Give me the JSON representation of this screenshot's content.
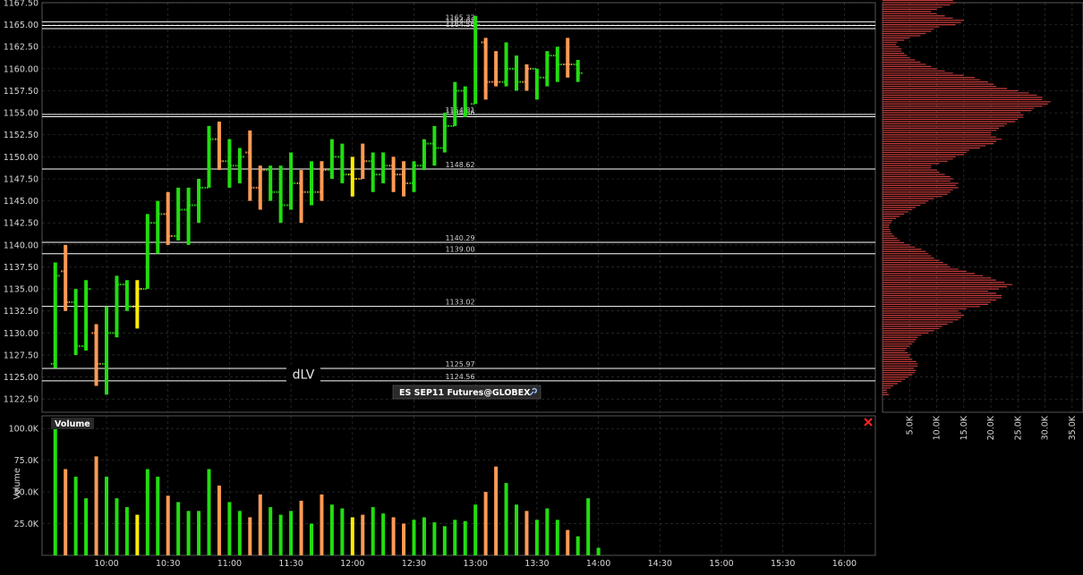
{
  "colors": {
    "background": "#000000",
    "grid": "#3a3a3a",
    "up": "#22dd11",
    "down": "#ff9a55",
    "neutral": "#ffee00",
    "level_line": "#ffffff",
    "profile": "#c83c3c",
    "label_bg": "#2a2a2a",
    "close_icon": "#ff2222"
  },
  "chart_data": [
    {
      "type": "ohlc",
      "title": "ES SEP11 Futures@GLOBEX",
      "title_icon": "wrench-icon",
      "ylim": [
        1121.0,
        1167.5
      ],
      "yticks": [
        "1122.50",
        "1125.00",
        "1127.50",
        "1130.00",
        "1132.50",
        "1135.00",
        "1137.50",
        "1140.00",
        "1142.50",
        "1145.00",
        "1147.50",
        "1150.00",
        "1152.50",
        "1155.00",
        "1157.50",
        "1160.00",
        "1162.50",
        "1165.00",
        "1167.50"
      ],
      "xticks": [
        "10:00",
        "10:30",
        "11:00",
        "11:30",
        "12:00",
        "12:30",
        "13:00",
        "13:30",
        "14:00",
        "14:30",
        "15:00",
        "15:30",
        "16:00"
      ],
      "bar_interval": "5min",
      "first_bar_time": "09:35",
      "bars": [
        {
          "o": 1126.5,
          "h": 1138.0,
          "l": 1126.0,
          "c": 1136.5,
          "color": "up"
        },
        {
          "o": 1137.0,
          "h": 1140.0,
          "l": 1132.5,
          "c": 1133.5,
          "color": "down"
        },
        {
          "o": 1133.5,
          "h": 1135.0,
          "l": 1127.5,
          "c": 1128.5,
          "color": "up"
        },
        {
          "o": 1128.5,
          "h": 1136.0,
          "l": 1128.0,
          "c": 1135.0,
          "color": "up"
        },
        {
          "o": 1130.0,
          "h": 1131.0,
          "l": 1124.0,
          "c": 1126.5,
          "color": "down"
        },
        {
          "o": 1126.5,
          "h": 1133.0,
          "l": 1123.0,
          "c": 1130.0,
          "color": "up"
        },
        {
          "o": 1130.0,
          "h": 1136.5,
          "l": 1129.5,
          "c": 1135.5,
          "color": "up"
        },
        {
          "o": 1135.5,
          "h": 1136.0,
          "l": 1132.5,
          "c": 1133.0,
          "color": "up"
        },
        {
          "o": 1133.0,
          "h": 1136.0,
          "l": 1130.5,
          "c": 1135.0,
          "color": "neutral"
        },
        {
          "o": 1135.0,
          "h": 1143.5,
          "l": 1135.0,
          "c": 1142.5,
          "color": "up"
        },
        {
          "o": 1142.5,
          "h": 1145.0,
          "l": 1139.0,
          "c": 1143.5,
          "color": "up"
        },
        {
          "o": 1143.5,
          "h": 1146.0,
          "l": 1140.0,
          "c": 1141.0,
          "color": "down"
        },
        {
          "o": 1141.0,
          "h": 1146.5,
          "l": 1140.5,
          "c": 1144.0,
          "color": "up"
        },
        {
          "o": 1144.0,
          "h": 1146.5,
          "l": 1140.0,
          "c": 1144.5,
          "color": "up"
        },
        {
          "o": 1144.5,
          "h": 1147.5,
          "l": 1142.5,
          "c": 1146.5,
          "color": "up"
        },
        {
          "o": 1146.5,
          "h": 1153.5,
          "l": 1146.5,
          "c": 1152.0,
          "color": "up"
        },
        {
          "o": 1152.0,
          "h": 1154.0,
          "l": 1148.5,
          "c": 1149.5,
          "color": "down"
        },
        {
          "o": 1149.5,
          "h": 1152.0,
          "l": 1146.5,
          "c": 1149.0,
          "color": "up"
        },
        {
          "o": 1149.0,
          "h": 1151.0,
          "l": 1147.0,
          "c": 1150.0,
          "color": "up"
        },
        {
          "o": 1150.5,
          "h": 1153.0,
          "l": 1145.0,
          "c": 1146.5,
          "color": "down"
        },
        {
          "o": 1146.5,
          "h": 1149.0,
          "l": 1144.0,
          "c": 1148.5,
          "color": "down"
        },
        {
          "o": 1148.5,
          "h": 1149.0,
          "l": 1145.0,
          "c": 1146.0,
          "color": "up"
        },
        {
          "o": 1146.0,
          "h": 1149.0,
          "l": 1142.5,
          "c": 1144.5,
          "color": "up"
        },
        {
          "o": 1144.5,
          "h": 1150.5,
          "l": 1144.0,
          "c": 1147.0,
          "color": "up"
        },
        {
          "o": 1147.0,
          "h": 1148.5,
          "l": 1142.5,
          "c": 1146.0,
          "color": "down"
        },
        {
          "o": 1146.0,
          "h": 1149.5,
          "l": 1144.5,
          "c": 1146.0,
          "color": "up"
        },
        {
          "o": 1146.0,
          "h": 1149.5,
          "l": 1145.0,
          "c": 1148.5,
          "color": "down"
        },
        {
          "o": 1148.5,
          "h": 1152.0,
          "l": 1147.5,
          "c": 1150.0,
          "color": "up"
        },
        {
          "o": 1150.0,
          "h": 1151.5,
          "l": 1147.0,
          "c": 1148.0,
          "color": "up"
        },
        {
          "o": 1148.0,
          "h": 1150.0,
          "l": 1145.5,
          "c": 1147.5,
          "color": "neutral"
        },
        {
          "o": 1147.5,
          "h": 1151.5,
          "l": 1147.5,
          "c": 1149.5,
          "color": "down"
        },
        {
          "o": 1149.5,
          "h": 1150.5,
          "l": 1146.0,
          "c": 1148.0,
          "color": "up"
        },
        {
          "o": 1148.0,
          "h": 1150.5,
          "l": 1147.0,
          "c": 1149.0,
          "color": "up"
        },
        {
          "o": 1149.0,
          "h": 1150.0,
          "l": 1146.0,
          "c": 1148.0,
          "color": "down"
        },
        {
          "o": 1148.0,
          "h": 1149.5,
          "l": 1145.5,
          "c": 1147.0,
          "color": "down"
        },
        {
          "o": 1147.0,
          "h": 1149.5,
          "l": 1146.0,
          "c": 1149.0,
          "color": "up"
        },
        {
          "o": 1149.0,
          "h": 1152.0,
          "l": 1148.5,
          "c": 1151.5,
          "color": "up"
        },
        {
          "o": 1151.5,
          "h": 1153.5,
          "l": 1149.0,
          "c": 1151.0,
          "color": "up"
        },
        {
          "o": 1151.0,
          "h": 1155.0,
          "l": 1150.5,
          "c": 1153.5,
          "color": "up"
        },
        {
          "o": 1153.5,
          "h": 1158.5,
          "l": 1153.5,
          "c": 1157.5,
          "color": "up"
        },
        {
          "o": 1157.5,
          "h": 1158.0,
          "l": 1154.5,
          "c": 1155.0,
          "color": "up"
        },
        {
          "o": 1156.0,
          "h": 1166.0,
          "l": 1156.0,
          "c": 1165.0,
          "color": "up"
        },
        {
          "o": 1163.0,
          "h": 1163.5,
          "l": 1156.5,
          "c": 1158.5,
          "color": "down"
        },
        {
          "o": 1158.5,
          "h": 1162.0,
          "l": 1158.0,
          "c": 1158.5,
          "color": "down"
        },
        {
          "o": 1158.5,
          "h": 1163.0,
          "l": 1158.0,
          "c": 1160.0,
          "color": "up"
        },
        {
          "o": 1160.0,
          "h": 1161.5,
          "l": 1157.5,
          "c": 1158.5,
          "color": "up"
        },
        {
          "o": 1158.5,
          "h": 1160.5,
          "l": 1157.5,
          "c": 1160.0,
          "color": "down"
        },
        {
          "o": 1160.0,
          "h": 1160.0,
          "l": 1156.5,
          "c": 1159.0,
          "color": "up"
        },
        {
          "o": 1159.0,
          "h": 1162.0,
          "l": 1158.0,
          "c": 1161.5,
          "color": "up"
        },
        {
          "o": 1161.5,
          "h": 1162.5,
          "l": 1158.5,
          "c": 1160.5,
          "color": "up"
        },
        {
          "o": 1160.5,
          "h": 1163.5,
          "l": 1159.0,
          "c": 1160.5,
          "color": "down"
        },
        {
          "o": 1160.5,
          "h": 1161.0,
          "l": 1158.5,
          "c": 1159.5,
          "color": "up"
        }
      ],
      "levels": [
        {
          "value": 1165.33,
          "label": "1165.33"
        },
        {
          "value": 1164.91,
          "label": "1164.91"
        },
        {
          "value": 1164.56,
          "label": "1164.56"
        },
        {
          "value": 1154.81,
          "label": "1154.81"
        },
        {
          "value": 1154.56,
          "label": "1154.56"
        },
        {
          "value": 1148.62,
          "label": "1148.62"
        },
        {
          "value": 1140.29,
          "label": "1140.29"
        },
        {
          "value": 1139.0,
          "label": "1139.00"
        },
        {
          "value": 1133.02,
          "label": "1133.02"
        },
        {
          "value": 1125.97,
          "label": "1125.97"
        },
        {
          "value": 1124.56,
          "label": "1124.56"
        }
      ],
      "annotations": [
        {
          "text": "dLV",
          "value": 1125.3
        }
      ]
    },
    {
      "type": "bar",
      "title": "Volume",
      "ylabel": "Volume",
      "ylim": [
        0,
        110000
      ],
      "yticks": [
        "25.0K",
        "50.0K",
        "75.0K",
        "100.0K"
      ],
      "values": [
        102000,
        68000,
        62000,
        45000,
        78000,
        62000,
        45000,
        38000,
        32000,
        68000,
        62000,
        47000,
        42000,
        35000,
        35000,
        68000,
        55000,
        42000,
        35000,
        30000,
        48000,
        38000,
        32000,
        35000,
        43000,
        25000,
        48000,
        40000,
        37000,
        30000,
        32000,
        38000,
        33000,
        30000,
        25000,
        28000,
        30000,
        26000,
        23000,
        28000,
        27000,
        40000,
        50000,
        70000,
        57000,
        40000,
        35000,
        28000,
        37000,
        28000,
        20000,
        15000,
        45000,
        6000
      ]
    },
    {
      "type": "horizontal-bar",
      "title": "Volume Profile",
      "xticks": [
        "5.0K",
        "10.0K",
        "15.0K",
        "20.0K",
        "25.0K",
        "30.0K",
        "35.0K"
      ],
      "xlim": [
        0,
        37000
      ],
      "price_start": 1123.0,
      "price_step": 0.25,
      "values": [
        1200,
        900,
        800,
        1500,
        2000,
        2800,
        3500,
        4200,
        4800,
        5500,
        6000,
        6200,
        5800,
        6500,
        6500,
        6200,
        5500,
        5000,
        5200,
        4700,
        4200,
        4500,
        5000,
        5500,
        5900,
        6200,
        6500,
        7200,
        8500,
        9500,
        10500,
        11000,
        12000,
        13000,
        14000,
        14500,
        15000,
        14500,
        14000,
        15500,
        18000,
        19500,
        20000,
        21000,
        22000,
        22000,
        21000,
        19500,
        21500,
        23000,
        24000,
        22500,
        21000,
        20000,
        18500,
        17000,
        15500,
        14000,
        12500,
        12000,
        11200,
        10500,
        9500,
        9000,
        8500,
        8000,
        7200,
        6000,
        5000,
        4000,
        3200,
        2700,
        2200,
        1800,
        1500,
        1400,
        1200,
        1300,
        1600,
        1800,
        2500,
        3200,
        4000,
        4800,
        5500,
        6100,
        7000,
        8000,
        8500,
        9500,
        11000,
        12000,
        12500,
        13000,
        14000,
        13500,
        14000,
        12500,
        13000,
        12500,
        11500,
        10500,
        10000,
        9000,
        9000,
        10500,
        12000,
        13000,
        13500,
        15000,
        15500,
        16000,
        18000,
        19000,
        20500,
        21000,
        22000,
        21000,
        20000,
        20000,
        21000,
        21500,
        22500,
        23000,
        24500,
        25000,
        26000,
        26000,
        25500,
        27500,
        28000,
        29500,
        30500,
        31000,
        29500,
        29500,
        28500,
        27000,
        25000,
        23000,
        21000,
        20500,
        19500,
        18000,
        17000,
        15000,
        13000,
        11500,
        10000,
        9000,
        8000,
        7000,
        6000,
        5000,
        4500,
        4000,
        3500,
        3500,
        3000,
        2500,
        2700,
        4000,
        5000,
        7000,
        8000,
        9000,
        9500,
        10500,
        13500,
        14500,
        15000,
        13000,
        11500,
        10000,
        9000,
        10000,
        11000,
        12500,
        13500,
        13000,
        15000,
        16500,
        18000,
        19000,
        20500,
        22500,
        21500,
        19500,
        17500,
        16000,
        15000,
        13000,
        11500,
        9500,
        10500,
        11500,
        12500,
        13500,
        12000,
        10500,
        9500,
        8000,
        6500,
        5500,
        4500,
        3500,
        3000,
        3000,
        3500,
        4000,
        4500,
        4000,
        3500,
        2500,
        2000,
        1500,
        1200,
        1000
      ]
    }
  ]
}
